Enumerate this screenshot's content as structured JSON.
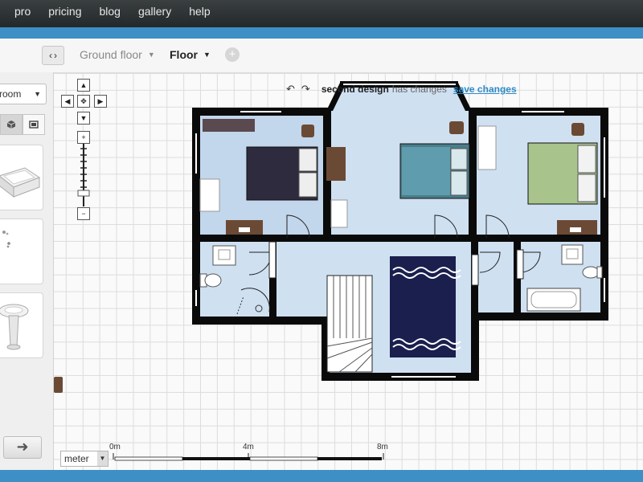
{
  "nav": [
    "pro",
    "pricing",
    "blog",
    "gallery",
    "help"
  ],
  "toolbar": {
    "nav_arrows": "‹›",
    "floors": [
      {
        "label": "Ground floor",
        "active": false
      },
      {
        "label": "Floor",
        "active": true
      }
    ],
    "add_floor_icon": "plus-circle-icon"
  },
  "sidebar": {
    "category": "room",
    "view_modes": [
      "3d-cube-icon",
      "2d-plan-icon"
    ],
    "items": [
      "bathtub",
      "shower-fittings",
      "pedestal-sink"
    ],
    "next_icon": "arrow-right-icon"
  },
  "status": {
    "undo_icon": "↶",
    "redo_icon": "↷",
    "design_name": "second design",
    "changed_text": "has changes",
    "save_label": "save changes"
  },
  "scale": {
    "unit": "meter",
    "labels": [
      "0m",
      "4m",
      "8m"
    ]
  },
  "colors": {
    "topbar": "#2e3335",
    "accent_blue": "#3d8fc6",
    "room_fill": "#c9dcef",
    "wall": "#0a0a0a",
    "link": "#2f8bc6"
  }
}
